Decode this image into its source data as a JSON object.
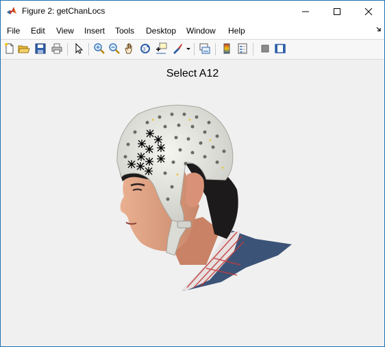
{
  "window": {
    "title": "Figure 2: getChanLocs"
  },
  "menu": {
    "items": [
      "File",
      "Edit",
      "View",
      "Insert",
      "Tools",
      "Desktop",
      "Window",
      "Help"
    ]
  },
  "toolbar": {
    "buttons": [
      "new-figure",
      "open-file",
      "save",
      "print",
      "edit-plot",
      "zoom-in",
      "zoom-out",
      "pan",
      "rotate-3d",
      "data-cursor",
      "brush",
      "link-plot",
      "insert-colorbar",
      "insert-legend",
      "hide-plot-tools",
      "show-plot-tools"
    ]
  },
  "axes": {
    "title": "Select A12"
  },
  "colors": {
    "canvas": "#f0f0f0",
    "window_border": "#1f6fb0"
  }
}
